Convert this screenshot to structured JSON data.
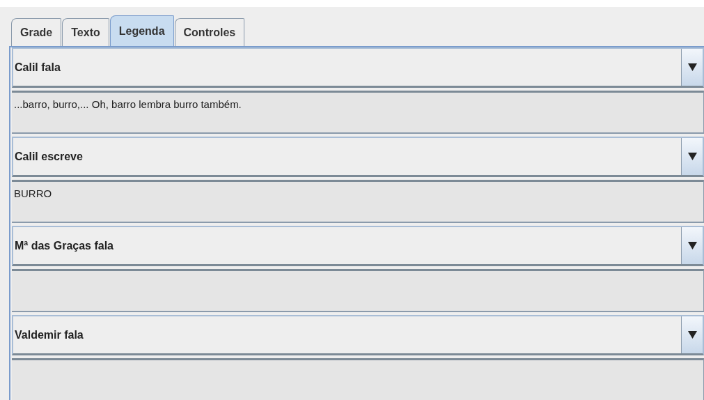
{
  "tabs": [
    {
      "label": "Grade",
      "selected": false
    },
    {
      "label": "Texto",
      "selected": false
    },
    {
      "label": "Legenda",
      "selected": true
    },
    {
      "label": "Controles",
      "selected": false
    }
  ],
  "captions": [
    {
      "speaker": "Calil fala",
      "text": "...barro, burro,... Oh, barro lembra burro também."
    },
    {
      "speaker": "Calil escreve",
      "text": "BURRO"
    },
    {
      "speaker": "Mª das Graças fala"
    },
    {
      "speaker": "Valdemir fala"
    }
  ]
}
